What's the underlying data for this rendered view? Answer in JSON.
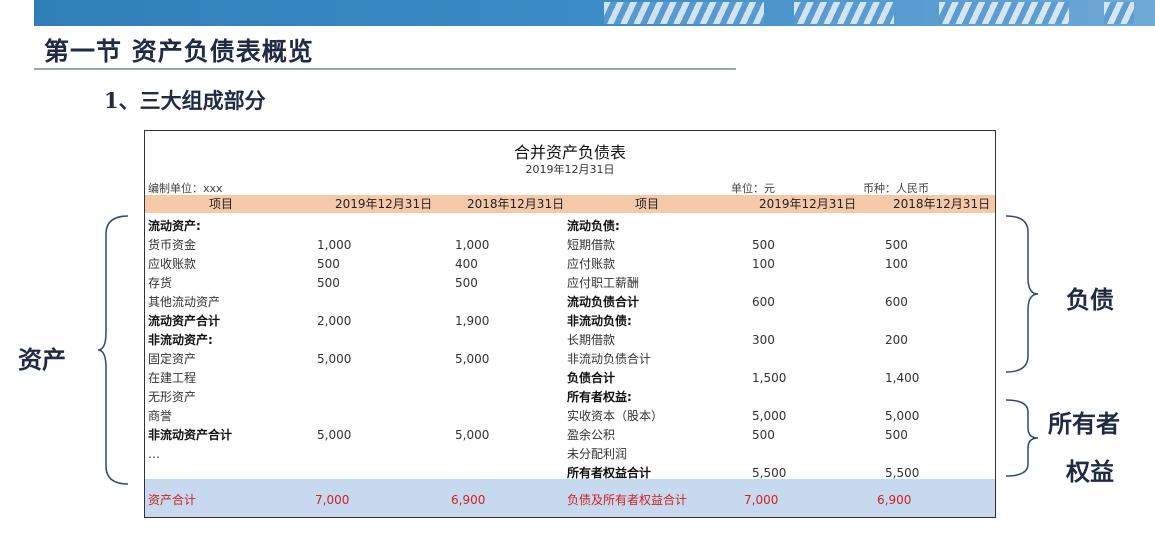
{
  "page_title": "第一节 资产负债表概览",
  "section_title": "1、三大组成部分",
  "sheet": {
    "title": "合并资产负债表",
    "date": "2019年12月31日",
    "compiler": "编制单位：xxx",
    "unit": "单位：元",
    "currency": "币种：人民币",
    "headers": [
      "项目",
      "2019年12月31日",
      "2018年12月31日",
      "项目",
      "2019年12月31日",
      "2018年12月31日"
    ],
    "left_rows": [
      {
        "label": "流动资产:",
        "v2019": "",
        "v2018": "",
        "bold": true
      },
      {
        "label": "货币资金",
        "v2019": "1,000",
        "v2018": "1,000",
        "bold": false
      },
      {
        "label": "应收账款",
        "v2019": "500",
        "v2018": "400",
        "bold": false
      },
      {
        "label": "存货",
        "v2019": "500",
        "v2018": "500",
        "bold": false
      },
      {
        "label": "其他流动资产",
        "v2019": "",
        "v2018": "",
        "bold": false
      },
      {
        "label": "流动资产合计",
        "v2019": "2,000",
        "v2018": "1,900",
        "bold": true
      },
      {
        "label": "非流动资产:",
        "v2019": "",
        "v2018": "",
        "bold": true
      },
      {
        "label": "固定资产",
        "v2019": "5,000",
        "v2018": "5,000",
        "bold": false
      },
      {
        "label": "在建工程",
        "v2019": "",
        "v2018": "",
        "bold": false
      },
      {
        "label": "无形资产",
        "v2019": "",
        "v2018": "",
        "bold": false
      },
      {
        "label": "商誉",
        "v2019": "",
        "v2018": "",
        "bold": false
      },
      {
        "label": "非流动资产合计",
        "v2019": "5,000",
        "v2018": "5,000",
        "bold": true
      },
      {
        "label": "…",
        "v2019": "",
        "v2018": "",
        "bold": false
      }
    ],
    "right_rows": [
      {
        "label": "流动负债:",
        "v2019": "",
        "v2018": "",
        "bold": true
      },
      {
        "label": "短期借款",
        "v2019": "500",
        "v2018": "500",
        "bold": false
      },
      {
        "label": "应付账款",
        "v2019": "100",
        "v2018": "100",
        "bold": false
      },
      {
        "label": "应付职工薪酬",
        "v2019": "",
        "v2018": "",
        "bold": false
      },
      {
        "label": "流动负债合计",
        "v2019": "600",
        "v2018": "600",
        "bold": true
      },
      {
        "label": "非流动负债:",
        "v2019": "",
        "v2018": "",
        "bold": true
      },
      {
        "label": "长期借款",
        "v2019": "300",
        "v2018": "200",
        "bold": false
      },
      {
        "label": "非流动负债合计",
        "v2019": "",
        "v2018": "",
        "bold": false
      },
      {
        "label": "负债合计",
        "v2019": "1,500",
        "v2018": "1,400",
        "bold": true
      },
      {
        "label": "所有者权益:",
        "v2019": "",
        "v2018": "",
        "bold": true
      },
      {
        "label": "实收资本（股本）",
        "v2019": "5,000",
        "v2018": "5,000",
        "bold": false
      },
      {
        "label": "盈余公积",
        "v2019": "500",
        "v2018": "500",
        "bold": false
      },
      {
        "label": "未分配利润",
        "v2019": "",
        "v2018": "",
        "bold": false
      },
      {
        "label": "所有者权益合计",
        "v2019": "5,500",
        "v2018": "5,500",
        "bold": true
      }
    ],
    "total_left": {
      "label": "资产合计",
      "v2019": "7,000",
      "v2018": "6,900"
    },
    "total_right": {
      "label": "负债及所有者权益合计",
      "v2019": "7,000",
      "v2018": "6,900"
    },
    "total_color": "#d42020",
    "header_color": "#f6c9a9",
    "total_band_color": "#c7d9ee"
  },
  "side_labels": {
    "assets": "资产",
    "liabilities": "负债",
    "equity_line1": "所有者",
    "equity_line2": "权益"
  }
}
